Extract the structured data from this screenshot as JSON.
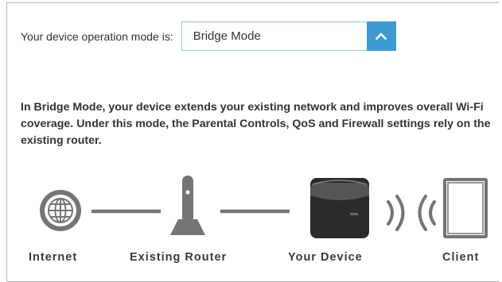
{
  "mode": {
    "label": "Your device operation mode is:",
    "selected": "Bridge Mode",
    "toggle_icon": "chevron-up-icon"
  },
  "description": "In Bridge Mode, your device extends your existing network and improves overall Wi-Fi coverage. Under this mode, the Parental Controls, QoS and Firewall settings rely on the existing router.",
  "diagram": {
    "nodes": [
      {
        "icon": "globe-icon",
        "label": "Internet"
      },
      {
        "icon": "router-icon",
        "label": "Existing Router"
      },
      {
        "icon": "extender-device-icon",
        "label": "Your Device"
      },
      {
        "icon": "tablet-icon",
        "label": "Client"
      }
    ],
    "wireless_icon": "wifi-signal-icon"
  },
  "colors": {
    "accent": "#3c9bd3",
    "select_border": "#9fc9e1",
    "icon_gray": "#747474"
  }
}
